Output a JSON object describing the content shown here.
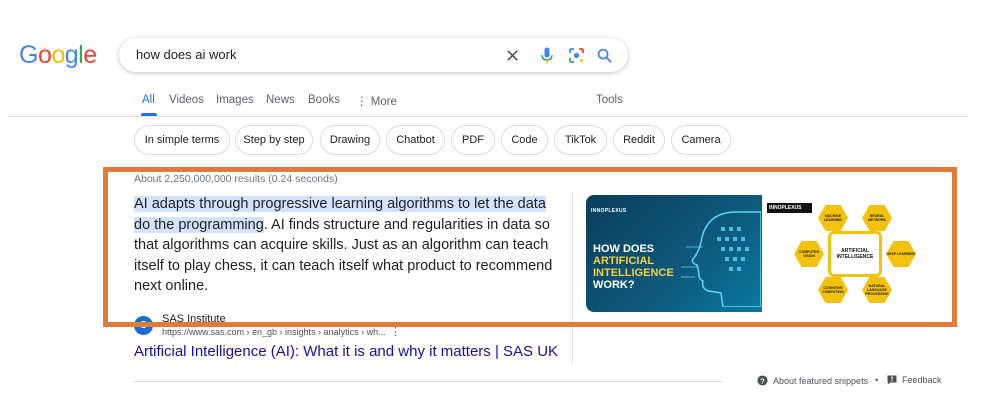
{
  "logo": {
    "letters": [
      "G",
      "o",
      "o",
      "g",
      "l",
      "e"
    ]
  },
  "search": {
    "query": "how does ai work"
  },
  "tabs": [
    {
      "label": "All",
      "active": true
    },
    {
      "label": "Videos"
    },
    {
      "label": "Images"
    },
    {
      "label": "News"
    },
    {
      "label": "Books"
    },
    {
      "label": "More"
    },
    {
      "label": "Tools"
    }
  ],
  "chips": [
    "In simple terms",
    "Step by step",
    "Drawing",
    "Chatbot",
    "PDF",
    "Code",
    "TikTok",
    "Reddit",
    "Camera"
  ],
  "result_stats": "About 2,250,000,000 results (0.24 seconds)",
  "featured_snippet": {
    "highlighted": "AI adapts through progressive learning algorithms to let the data do the programming",
    "rest": ". AI finds structure and regularities in data so that algorithms can acquire skills. Just as an algorithm can teach itself to play chess, it can teach itself what product to recommend next online.",
    "image_left": {
      "brand": "INNOPLEXUS",
      "line1": "HOW DOES",
      "line2": "ARTIFICIAL INTELLIGENCE",
      "line3": "WORK?"
    },
    "image_right": {
      "brand": "INNOPLEXUS",
      "hub": "ARTIFICIAL INTELLIGENCE",
      "nodes": [
        "MACHINE LEARNING",
        "NEURAL NETWORK",
        "COMPUTER VISION",
        "DEEP LEARNING",
        "COGNITIVE COMPUTING",
        "NATURAL LANGUAGE PROCESSING"
      ]
    }
  },
  "source": {
    "site_name": "SAS Institute",
    "url": "https://www.sas.com › en_gb › insights › analytics › wh...",
    "title": "Artificial Intelligence (AI): What it is and why it matters | SAS UK"
  },
  "footer": {
    "about": "About featured snippets",
    "separator": "•",
    "feedback": "Feedback"
  },
  "colors": {
    "accent": "#1a73e8",
    "link": "#1a0dab",
    "highlight_box": "#e07b39",
    "snippet_highlight": "#d3e3fd"
  },
  "icons": [
    "clear-icon",
    "microphone-icon",
    "lens-icon",
    "search-icon",
    "more-dots-icon",
    "question-circle-icon",
    "feedback-icon"
  ]
}
